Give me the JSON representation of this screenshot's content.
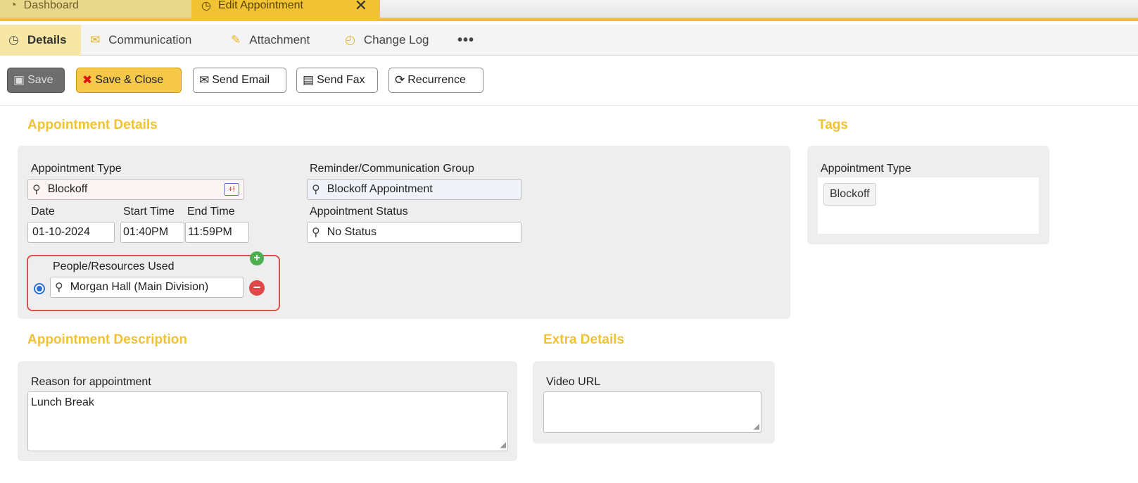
{
  "window_tabs": [
    {
      "label": "Dashboard",
      "icon": "dashboard-icon"
    },
    {
      "label": "Edit Appointment",
      "icon": "clock-icon",
      "close": "✕"
    }
  ],
  "section_tabs": [
    {
      "label": "Details",
      "icon": "clock-icon",
      "active": true
    },
    {
      "label": "Communication",
      "icon": "envelope-icon"
    },
    {
      "label": "Attachment",
      "icon": "paperclip-icon"
    },
    {
      "label": "Change Log",
      "icon": "history-icon"
    },
    {
      "label": "•••",
      "icon": "more-icon"
    }
  ],
  "toolbar": {
    "save_label": "Save",
    "save_close_label": "Save & Close",
    "send_email_label": "Send Email",
    "send_fax_label": "Send Fax",
    "recurrence_label": "Recurrence"
  },
  "appointment_details": {
    "title": "Appointment Details",
    "appointment_type_label": "Appointment Type",
    "appointment_type_value": "Blockoff",
    "date_label": "Date",
    "date_value": "01-10-2024",
    "start_time_label": "Start Time",
    "start_time_value": "01:40PM",
    "end_time_label": "End Time",
    "end_time_value": "11:59PM",
    "reminder_group_label": "Reminder/Communication Group",
    "reminder_group_value": "Blockoff Appointment",
    "status_label": "Appointment Status",
    "status_value": "No Status",
    "resources_label": "People/Resources Used",
    "resources_value": "Morgan Hall (Main Division)"
  },
  "tags": {
    "title": "Tags",
    "appointment_type_label": "Appointment Type",
    "items": [
      "Blockoff"
    ]
  },
  "description": {
    "title": "Appointment Description",
    "reason_label": "Reason for appointment",
    "reason_value": "Lunch Break"
  },
  "extra": {
    "title": "Extra Details",
    "video_url_label": "Video URL",
    "video_url_value": ""
  },
  "colors": {
    "accent": "#f1c232",
    "highlight": "#d9534f"
  }
}
